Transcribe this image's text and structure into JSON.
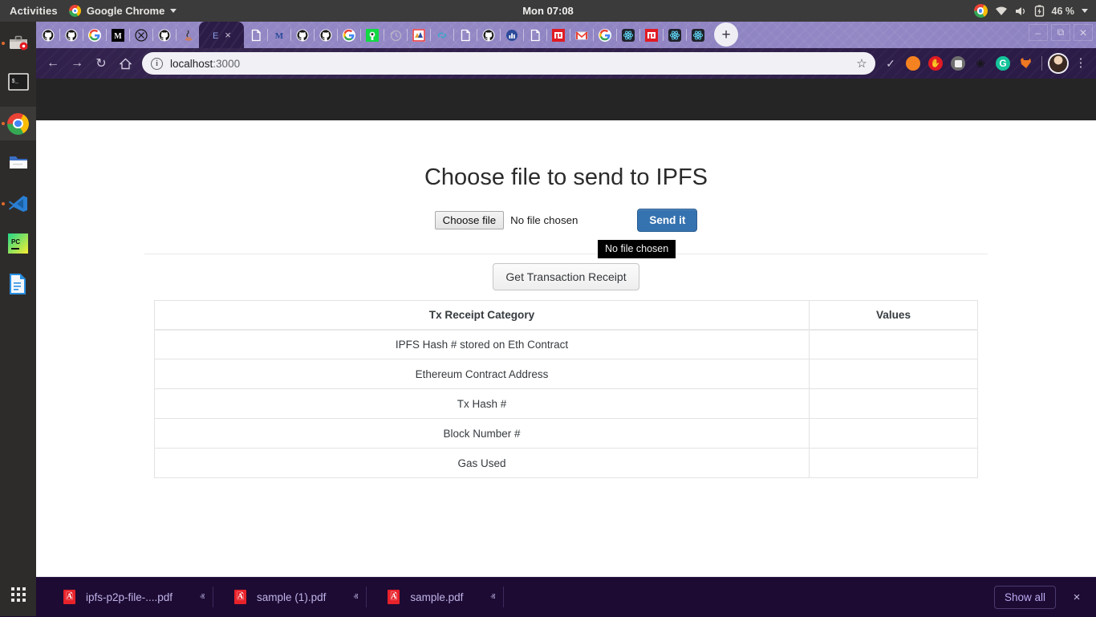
{
  "desktop": {
    "activities_label": "Activities",
    "app_name": "Google Chrome",
    "clock": "Mon 07:08",
    "battery_percent": "46 %",
    "tray_icons": [
      "wifi-icon",
      "volume-icon",
      "battery-charging-icon"
    ],
    "dock_items": [
      {
        "name": "dock-item-toolbox",
        "icon": "toolbox-icon",
        "running": true,
        "active": false
      },
      {
        "name": "dock-item-terminal",
        "icon": "terminal-icon",
        "running": false,
        "active": false
      },
      {
        "name": "dock-item-chrome",
        "icon": "chrome-icon",
        "running": true,
        "active": true
      },
      {
        "name": "dock-item-files",
        "icon": "folder-icon",
        "running": false,
        "active": false
      },
      {
        "name": "dock-item-vscode",
        "icon": "vscode-icon",
        "running": true,
        "active": false
      },
      {
        "name": "dock-item-pycharm",
        "icon": "pycharm-icon",
        "running": false,
        "active": false
      },
      {
        "name": "dock-item-libreoffice",
        "icon": "libreoffice-writer-icon",
        "running": false,
        "active": false
      }
    ],
    "show_apps_label": "show-applications-icon"
  },
  "browser": {
    "window_controls": [
      "minimize",
      "maximize",
      "close"
    ],
    "new_tab_label": "+",
    "tabs": [
      {
        "favicon": "github-icon",
        "selected": false
      },
      {
        "favicon": "github-icon",
        "selected": false
      },
      {
        "favicon": "google-icon",
        "selected": false
      },
      {
        "favicon": "medium-icon",
        "selected": false
      },
      {
        "favicon": "x-circle-icon",
        "selected": false
      },
      {
        "favicon": "github-icon",
        "selected": false
      },
      {
        "favicon": "java-icon",
        "selected": false
      },
      {
        "favicon": "letter-e-icon",
        "selected": true,
        "close_label": "×"
      },
      {
        "favicon": "blank-page-icon",
        "selected": false
      },
      {
        "favicon": "medium-letter-icon",
        "selected": false
      },
      {
        "favicon": "github-icon",
        "selected": false
      },
      {
        "favicon": "github-icon",
        "selected": false
      },
      {
        "favicon": "google-icon",
        "selected": false
      },
      {
        "favicon": "green-app-icon",
        "selected": false
      },
      {
        "favicon": "history-clock-icon",
        "selected": false
      },
      {
        "favicon": "ipfs-icon",
        "selected": false
      },
      {
        "favicon": "link-chain-icon",
        "selected": false
      },
      {
        "favicon": "blank-page-icon",
        "selected": false
      },
      {
        "favicon": "github-icon",
        "selected": false
      },
      {
        "favicon": "stats-icon",
        "selected": false
      },
      {
        "favicon": "blank-page-icon",
        "selected": false
      },
      {
        "favicon": "npm-icon",
        "selected": false
      },
      {
        "favicon": "gmail-icon",
        "selected": false
      },
      {
        "favicon": "google-icon",
        "selected": false
      },
      {
        "favicon": "react-icon",
        "selected": false
      },
      {
        "favicon": "npm-icon",
        "selected": false
      },
      {
        "favicon": "react-icon",
        "selected": false
      },
      {
        "favicon": "react-icon",
        "selected": false
      }
    ],
    "nav": {
      "back_label": "←",
      "forward_label": "→",
      "reload_label": "↻",
      "home_label": "⌂"
    },
    "omnibox": {
      "host": "localhost",
      "port": ":3000",
      "info_label": "i",
      "bookmark_star_label": "☆"
    },
    "extensions": [
      {
        "name": "extension-check",
        "glyph": "✓",
        "color": "#cfc8dd"
      },
      {
        "name": "extension-orange",
        "glyph": "",
        "color": "#f58220"
      },
      {
        "name": "extension-red-hand",
        "glyph": "✋",
        "color": "#e01b24"
      },
      {
        "name": "extension-video",
        "glyph": "■",
        "color": "#6e6e6e"
      },
      {
        "name": "extension-dark-leaf",
        "glyph": "❀",
        "color": "#111111"
      },
      {
        "name": "extension-grammarly",
        "glyph": "G",
        "color": "#15c39a"
      },
      {
        "name": "extension-fox",
        "glyph": "◀",
        "color": "#f07822"
      }
    ],
    "profile_label": "avatar",
    "menu_label": "⋮"
  },
  "page": {
    "title": "Choose file to send to IPFS",
    "file_input": {
      "button_label": "Choose file",
      "status_label": "No file chosen",
      "tooltip": "No file chosen"
    },
    "send_button_label": "Send it",
    "receipt_button_label": "Get Transaction Receipt",
    "table": {
      "headers": [
        "Tx Receipt Category",
        "Values"
      ],
      "rows": [
        {
          "category": "IPFS Hash # stored on Eth Contract",
          "value": ""
        },
        {
          "category": "Ethereum Contract Address",
          "value": ""
        },
        {
          "category": "Tx Hash #",
          "value": ""
        },
        {
          "category": "Block Number #",
          "value": ""
        },
        {
          "category": "Gas Used",
          "value": ""
        }
      ]
    }
  },
  "download_shelf": {
    "items": [
      {
        "filename": "ipfs-p2p-file-....pdf",
        "caret_label": "ⱏ"
      },
      {
        "filename": "sample (1).pdf",
        "caret_label": "ⱏ"
      },
      {
        "filename": "sample.pdf",
        "caret_label": "ⱏ"
      }
    ],
    "show_all_label": "Show all",
    "close_label": "×"
  },
  "colors": {
    "accent_blue": "#3572b0",
    "shelf_bg": "#1d0b33",
    "tabstrip_purple": "#8b7fc0",
    "toolbar_purple": "#2b1b47",
    "dark_band": "#252525",
    "download_link": "#bfb4e8"
  }
}
